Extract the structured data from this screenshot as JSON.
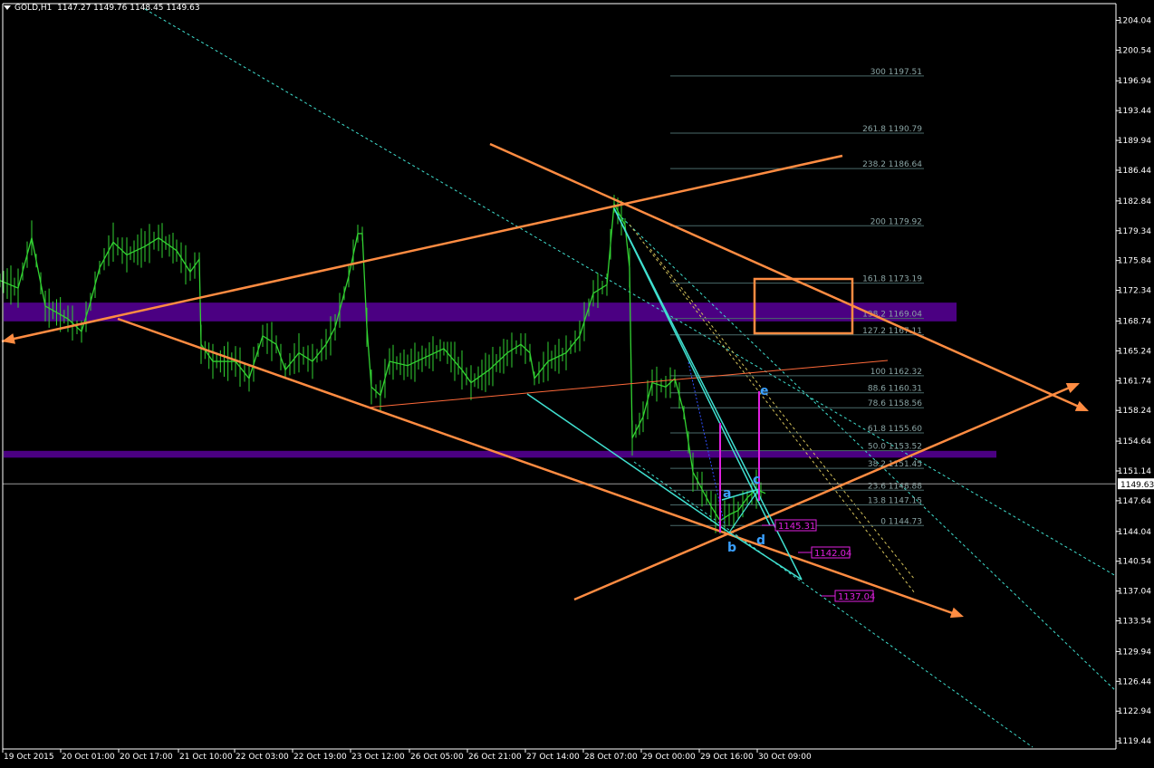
{
  "header": {
    "symbol": "GOLD,H1",
    "ohlc": "1147.27 1149.76 1148.45 1149.63"
  },
  "price_tag": "1149.63",
  "colors": {
    "background": "#000000",
    "axis": "#ffffff",
    "candle": "#32d232",
    "orange": "#ff8c42",
    "cyan": "#40e0d0",
    "purple_zone": "#4b0082",
    "magenta": "#e020e0",
    "fib": "#4a6a6a",
    "label_blue": "#3aa0ff"
  },
  "chart_data": {
    "type": "line",
    "title": "GOLD,H1",
    "y_ticks": [
      "1204.04",
      "1200.54",
      "1196.94",
      "1193.44",
      "1189.94",
      "1186.44",
      "1182.84",
      "1179.34",
      "1175.84",
      "1172.34",
      "1168.74",
      "1165.24",
      "1161.74",
      "1158.24",
      "1154.64",
      "1151.14",
      "1147.64",
      "1144.04",
      "1140.54",
      "1137.04",
      "1133.54",
      "1129.94",
      "1126.44",
      "1122.94",
      "1119.44"
    ],
    "x_ticks": [
      "19 Oct 2015",
      "20 Oct 01:00",
      "20 Oct 17:00",
      "21 Oct 10:00",
      "22 Oct 03:00",
      "22 Oct 19:00",
      "23 Oct 12:00",
      "26 Oct 05:00",
      "26 Oct 21:00",
      "27 Oct 14:00",
      "28 Oct 07:00",
      "29 Oct 00:00",
      "29 Oct 16:00",
      "30 Oct 09:00"
    ],
    "ylim": [
      1118.5,
      1206.0
    ],
    "price_path": [
      [
        0,
        1173.5
      ],
      [
        20,
        1172.6
      ],
      [
        35,
        1178.5
      ],
      [
        50,
        1170.5
      ],
      [
        75,
        1169.0
      ],
      [
        90,
        1167.5
      ],
      [
        100,
        1171
      ],
      [
        110,
        1175
      ],
      [
        125,
        1178
      ],
      [
        140,
        1176.5
      ],
      [
        160,
        1177.5
      ],
      [
        175,
        1178.5
      ],
      [
        195,
        1177
      ],
      [
        210,
        1174.5
      ],
      [
        220,
        1176
      ],
      [
        222,
        1166
      ],
      [
        235,
        1164
      ],
      [
        260,
        1164
      ],
      [
        275,
        1162
      ],
      [
        290,
        1167
      ],
      [
        305,
        1166
      ],
      [
        315,
        1163
      ],
      [
        330,
        1165
      ],
      [
        345,
        1164
      ],
      [
        360,
        1166
      ],
      [
        370,
        1168
      ],
      [
        385,
        1174
      ],
      [
        395,
        1179
      ],
      [
        400,
        1179
      ],
      [
        405,
        1168
      ],
      [
        410,
        1161
      ],
      [
        420,
        1160
      ],
      [
        430,
        1164
      ],
      [
        450,
        1163.5
      ],
      [
        470,
        1164.5
      ],
      [
        490,
        1165.5
      ],
      [
        510,
        1163
      ],
      [
        520,
        1161.5
      ],
      [
        540,
        1163
      ],
      [
        560,
        1165
      ],
      [
        575,
        1166
      ],
      [
        585,
        1165
      ],
      [
        590,
        1162
      ],
      [
        605,
        1164
      ],
      [
        625,
        1165
      ],
      [
        640,
        1167
      ],
      [
        655,
        1172
      ],
      [
        670,
        1173
      ],
      [
        678,
        1182.5
      ],
      [
        690,
        1180
      ],
      [
        695,
        1175
      ],
      [
        698,
        1155
      ],
      [
        710,
        1157.5
      ],
      [
        720,
        1161.5
      ],
      [
        735,
        1161
      ],
      [
        745,
        1162
      ],
      [
        755,
        1158
      ],
      [
        765,
        1151
      ],
      [
        775,
        1149
      ],
      [
        785,
        1147
      ],
      [
        795,
        1145.3
      ],
      [
        805,
        1146
      ],
      [
        815,
        1146.5
      ],
      [
        825,
        1148
      ],
      [
        835,
        1149
      ],
      [
        845,
        1148.5
      ]
    ],
    "fib_levels": [
      {
        "ratio": "300",
        "price": "1197.51",
        "y": 1197.51
      },
      {
        "ratio": "261.8",
        "price": "1190.79",
        "y": 1190.79
      },
      {
        "ratio": "238.2",
        "price": "1186.64",
        "y": 1186.64
      },
      {
        "ratio": "200",
        "price": "1179.92",
        "y": 1179.92
      },
      {
        "ratio": "161.8",
        "price": "1173.19",
        "y": 1173.19
      },
      {
        "ratio": "138.2",
        "price": "1169.04",
        "y": 1169.04
      },
      {
        "ratio": "127.2",
        "price": "1167.11",
        "y": 1167.11
      },
      {
        "ratio": "100",
        "price": "1162.32",
        "y": 1162.32
      },
      {
        "ratio": "88.6",
        "price": "1160.31",
        "y": 1160.31
      },
      {
        "ratio": "78.6",
        "price": "1158.56",
        "y": 1158.56
      },
      {
        "ratio": "61.8",
        "price": "1155.60",
        "y": 1155.6
      },
      {
        "ratio": "50.0",
        "price": "1153.52",
        "y": 1153.52
      },
      {
        "ratio": "38.2",
        "price": "1151.45",
        "y": 1151.45
      },
      {
        "ratio": "23.6",
        "price": "1148.88",
        "y": 1148.88
      },
      {
        "ratio": "13.8",
        "price": "1147.15",
        "y": 1147.15
      },
      {
        "ratio": "0",
        "price": "1144.73",
        "y": 1144.73
      }
    ],
    "target_labels": [
      "1145.31",
      "1142.04",
      "1137.04"
    ],
    "wave_labels": [
      "a",
      "b",
      "c",
      "d",
      "e"
    ],
    "zones": [
      {
        "name": "upper-resistance-zone",
        "from": 1168.7,
        "to": 1170.9
      },
      {
        "name": "lower-support-zone",
        "from": 1152.7,
        "to": 1153.5
      }
    ],
    "grid": false
  }
}
